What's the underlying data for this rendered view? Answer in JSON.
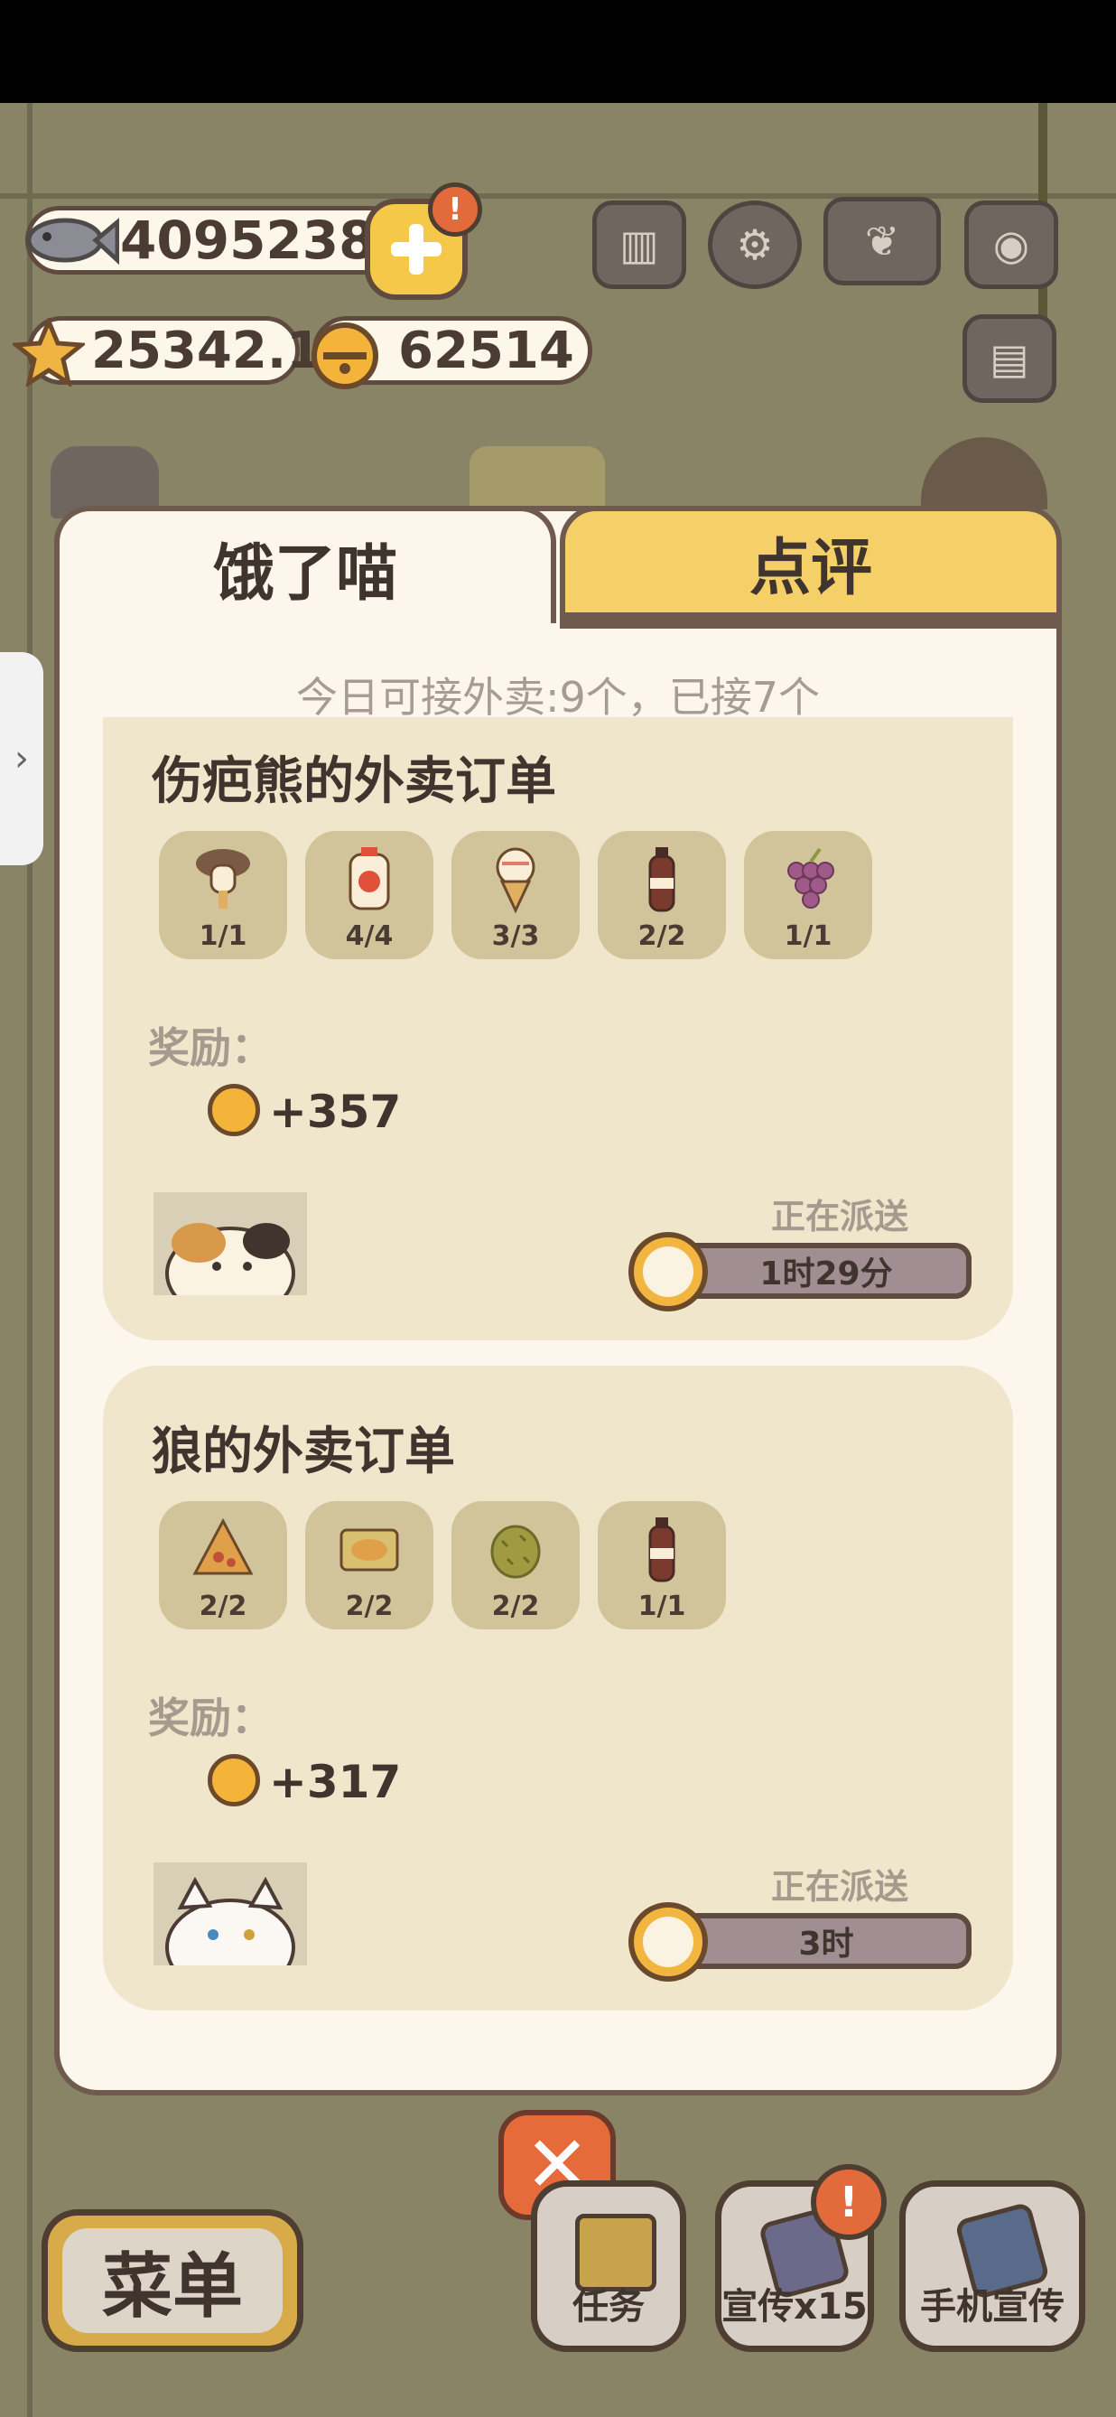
{
  "currencies": {
    "fish": "4095238",
    "stars": "25342.1",
    "bells": "62514"
  },
  "tabs": {
    "active": "饿了喵",
    "inactive": "点评"
  },
  "summary": "今日可接外卖:9个，已接7个",
  "orders": [
    {
      "title": "伤疤熊的外卖订单",
      "items": [
        {
          "icon": "mushroom-icon",
          "count": "1/1"
        },
        {
          "icon": "strawberry-jam-icon",
          "count": "4/4"
        },
        {
          "icon": "ice-cream-icon",
          "count": "3/3"
        },
        {
          "icon": "cola-bottle-icon",
          "count": "2/2"
        },
        {
          "icon": "grapes-icon",
          "count": "1/1"
        }
      ],
      "reward_label": "奖励：",
      "reward": "+357",
      "status": "正在派送",
      "timer": "1时29分"
    },
    {
      "title": "狼的外卖订单",
      "items": [
        {
          "icon": "pizza-slice-icon",
          "count": "2/2"
        },
        {
          "icon": "fish-cake-icon",
          "count": "2/2"
        },
        {
          "icon": "durian-icon",
          "count": "2/2"
        },
        {
          "icon": "cola-bottle-icon",
          "count": "1/1"
        }
      ],
      "reward_label": "奖励：",
      "reward": "+317",
      "status": "正在派送",
      "timer": "3时"
    }
  ],
  "bottom": {
    "menu": "菜单",
    "tasks": "任务",
    "promo": "宣传x15",
    "phone_promo": "手机宣传",
    "alert": "!"
  },
  "colors": {
    "panel": "#fcf6ec",
    "tab_inactive": "#f5cf68",
    "order_card": "#efe6cb",
    "item_tile": "#d2c49a",
    "close": "#e56b3a"
  }
}
